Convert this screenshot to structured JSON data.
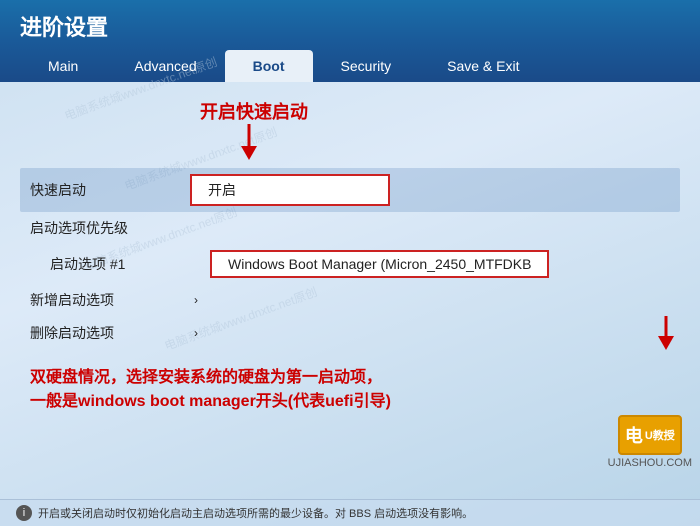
{
  "header": {
    "title": "进阶设置",
    "watermark_text": "原创"
  },
  "tabs": [
    {
      "id": "main",
      "label": "Main",
      "active": false
    },
    {
      "id": "advanced",
      "label": "Advanced",
      "active": false
    },
    {
      "id": "boot",
      "label": "Boot",
      "active": true
    },
    {
      "id": "security",
      "label": "Security",
      "active": false
    },
    {
      "id": "save-exit",
      "label": "Save & Exit",
      "active": false
    }
  ],
  "annotation_top": {
    "text": "开启快速启动"
  },
  "menu_rows": [
    {
      "id": "fast-boot",
      "label": "快速启动",
      "value": "开启",
      "has_value_box": true,
      "highlighted": true
    },
    {
      "id": "boot-option-priority",
      "label": "启动选项优先级",
      "value": "",
      "has_value_box": false,
      "highlighted": false
    },
    {
      "id": "boot-option-1",
      "label": "启动选项 #1",
      "value": "Windows Boot Manager (Micron_2450_MTFDKB",
      "has_value_box": true,
      "highlighted": false
    },
    {
      "id": "add-boot-option",
      "label": "新增启动选项",
      "value": "",
      "has_value_box": false,
      "highlighted": false,
      "has_chevron": true
    },
    {
      "id": "delete-boot-option",
      "label": "删除启动选项",
      "value": "",
      "has_value_box": false,
      "highlighted": false,
      "has_chevron": true
    }
  ],
  "annotation_bottom": {
    "line1": "双硬盘情况，选择安装系统的硬盘为第一启动项，",
    "line2": "一般是windows boot manager开头(代表uefi引导)"
  },
  "info_bar": {
    "text": "开启或关闭启动时仅初始化启动主启动选项所需的最少设备。对 BBS 启动选项没有影响。"
  },
  "corner_logo": {
    "icon": "电",
    "subtext": "U教授",
    "site": "UJIASHOU.COM"
  }
}
